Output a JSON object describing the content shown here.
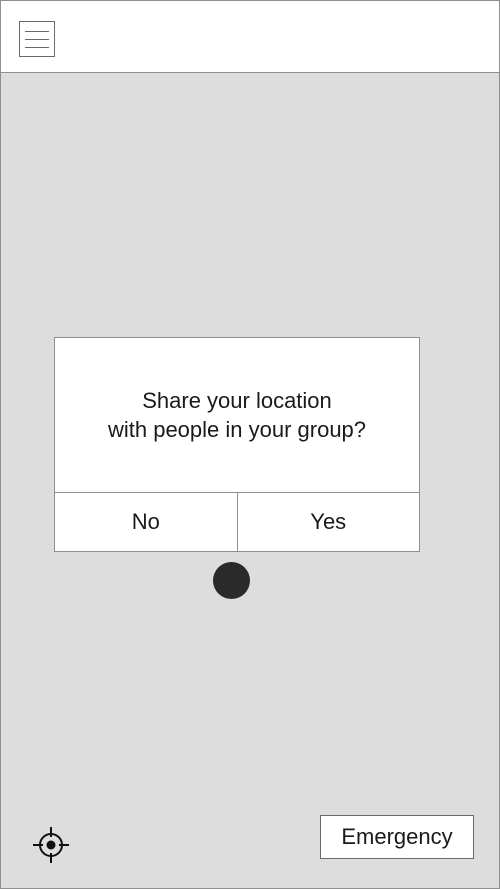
{
  "header": {
    "menu_icon": "hamburger-menu-icon"
  },
  "dialog": {
    "message_line1": "Share your location",
    "message_line2": "with people in your group?",
    "no_label": "No",
    "yes_label": "Yes"
  },
  "map": {
    "background_color": "#dddddd",
    "location_marker_color": "#2a2a2a",
    "locate_icon": "crosshair-locate-icon"
  },
  "footer": {
    "emergency_label": "Emergency"
  }
}
